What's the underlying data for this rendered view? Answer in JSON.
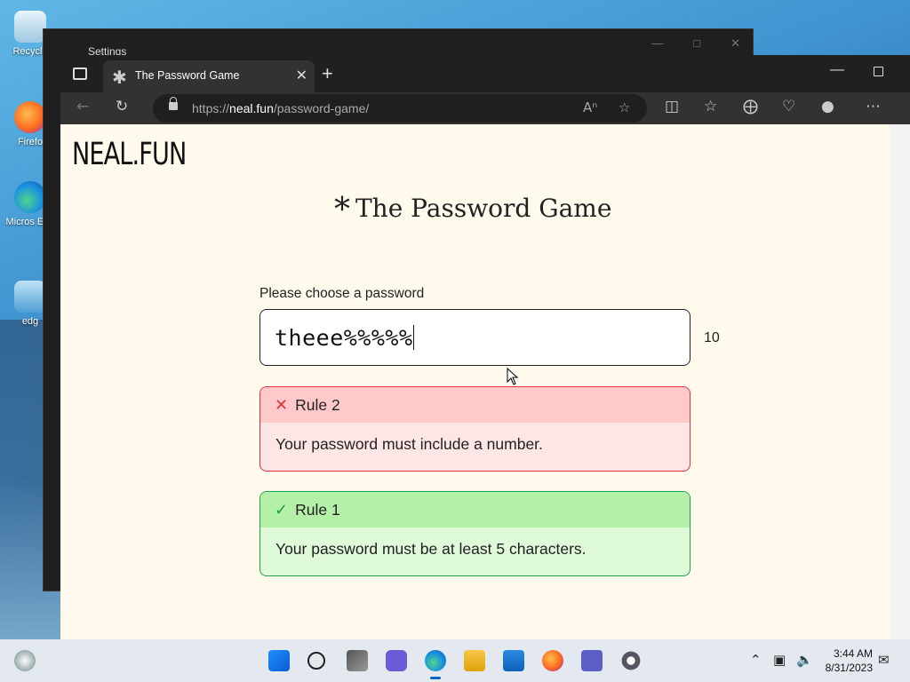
{
  "desktop": {
    "icons": [
      {
        "label": "Recycle"
      },
      {
        "label": "Firefo"
      },
      {
        "label": "Micros Edg"
      },
      {
        "label": "edg"
      }
    ]
  },
  "settings_window": {
    "title": "Settings"
  },
  "browser": {
    "tab_title": "The Password Game",
    "url_prefix": "https://",
    "url_host": "neal.fun",
    "url_path": "/password-game/"
  },
  "page": {
    "logo": "NEAL.FUN",
    "title": "The Password Game",
    "title_symbol": "*",
    "password_label": "Please choose a password",
    "password_value": "theee%%%%%",
    "char_count": "10",
    "rules": [
      {
        "status": "failed",
        "title": "Rule 2",
        "text": "Your password must include a number."
      },
      {
        "status": "passed",
        "title": "Rule 1",
        "text": "Your password must be at least 5 characters."
      }
    ]
  },
  "taskbar": {
    "time": "3:44 AM",
    "date": "8/31/2023"
  },
  "colors": {
    "page_bg": "#fffaec",
    "rule_fail_border": "#e0313a",
    "rule_fail_header": "#ffc9c9",
    "rule_pass_border": "#1ea34a",
    "rule_pass_header": "#b5f0a8"
  }
}
